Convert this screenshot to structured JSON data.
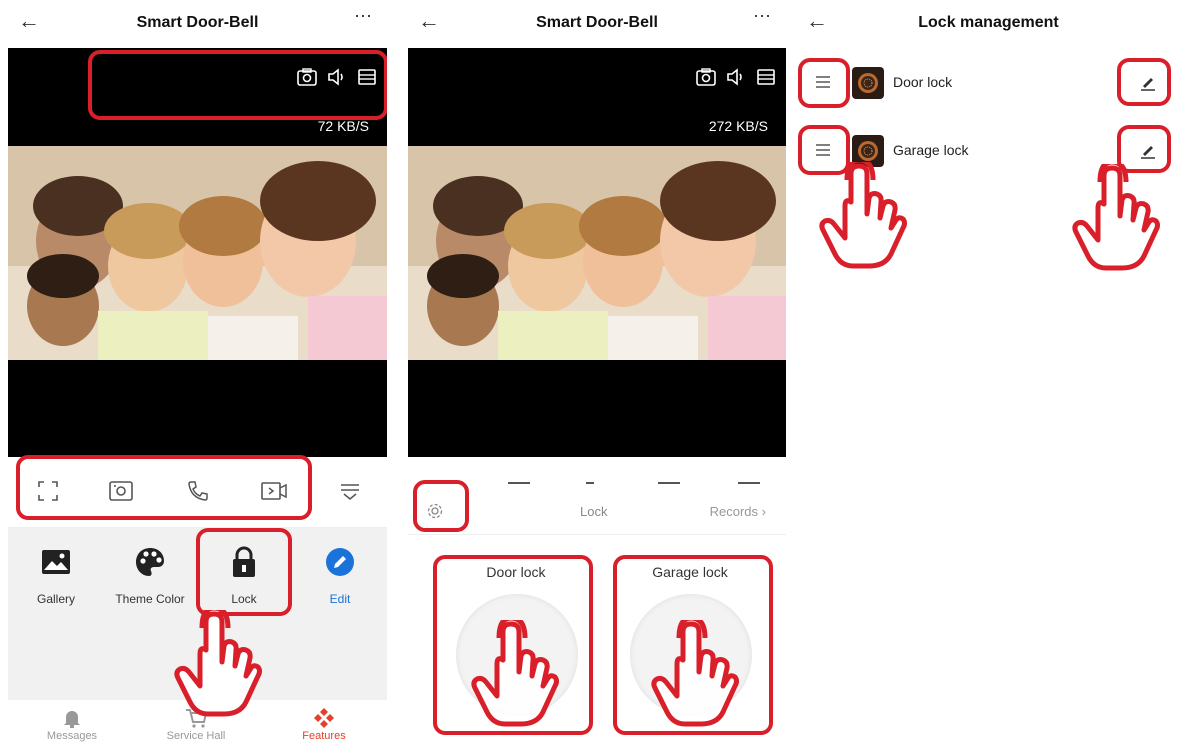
{
  "colors": {
    "accent": "#e5402c",
    "highlight": "#d81f2a",
    "edit_blue": "#1a73d9",
    "video_bg": "#000000"
  },
  "panel1": {
    "header": {
      "title": "Smart Door-Bell",
      "back_icon": "arrow-left-icon",
      "more_icon": "more-dots-icon"
    },
    "video": {
      "speed": "72 KB/S"
    },
    "features": [
      {
        "label": "Gallery",
        "icon": "image-icon"
      },
      {
        "label": "Theme Color",
        "icon": "palette-icon"
      },
      {
        "label": "Lock",
        "icon": "lock-icon"
      },
      {
        "label": "Edit",
        "icon": "edit-icon"
      }
    ],
    "tabs": [
      {
        "label": "Messages",
        "icon": "bell-icon"
      },
      {
        "label": "Service Hall",
        "icon": "cart-icon"
      },
      {
        "label": "Features",
        "icon": "features-icon"
      }
    ]
  },
  "panel2": {
    "header": {
      "title": "Smart Door-Bell"
    },
    "video": {
      "speed": "272 KB/S"
    },
    "lock_tab": "Lock",
    "records": "Records",
    "locks": [
      {
        "label": "Door lock"
      },
      {
        "label": "Garage lock"
      }
    ]
  },
  "panel3": {
    "header": {
      "title": "Lock management"
    },
    "locks": [
      {
        "name": "Door lock"
      },
      {
        "name": "Garage lock"
      }
    ]
  }
}
